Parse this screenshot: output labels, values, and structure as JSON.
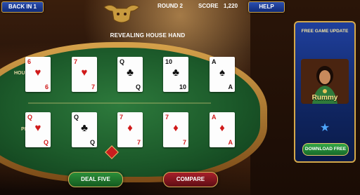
{
  "header": {
    "back_label": "BACK IN 1",
    "round_label": "ROUND 2",
    "score_label": "SCORE",
    "score_value": "1,220",
    "help_label": "HELP"
  },
  "status": "REVEALING HOUSE HAND",
  "table": {
    "house_label": "HOUSE",
    "player_label": "PLAYER",
    "house_cards": [
      {
        "rank": "6",
        "suit": "♥",
        "color": "red"
      },
      {
        "rank": "7",
        "suit": "♥",
        "color": "red"
      },
      {
        "rank": "Q",
        "suit": "♣",
        "color": "black"
      },
      {
        "rank": "10",
        "suit": "♣",
        "color": "black"
      },
      {
        "rank": "A",
        "suit": "♠",
        "color": "black"
      }
    ],
    "player_cards": [
      {
        "rank": "Q",
        "suit": "♥",
        "color": "red"
      },
      {
        "rank": "Q",
        "suit": "♣",
        "color": "black"
      },
      {
        "rank": "7",
        "suit": "♦",
        "color": "red"
      },
      {
        "rank": "7",
        "suit": "♦",
        "color": "red"
      },
      {
        "rank": "A",
        "suit": "♦",
        "color": "red"
      }
    ]
  },
  "actions": {
    "deal_label": "DEAL FIVE",
    "compare_label": "COMPARE"
  },
  "promo": {
    "title": "FREE GAME UPDATE",
    "name": "Rummy",
    "button_label": "DOWNLOAD FREE"
  },
  "colors": {
    "card_red": "#d01a1a",
    "card_black": "#111111",
    "felt_green": "#1c5a2a",
    "gold_trim": "#d4a84a"
  }
}
